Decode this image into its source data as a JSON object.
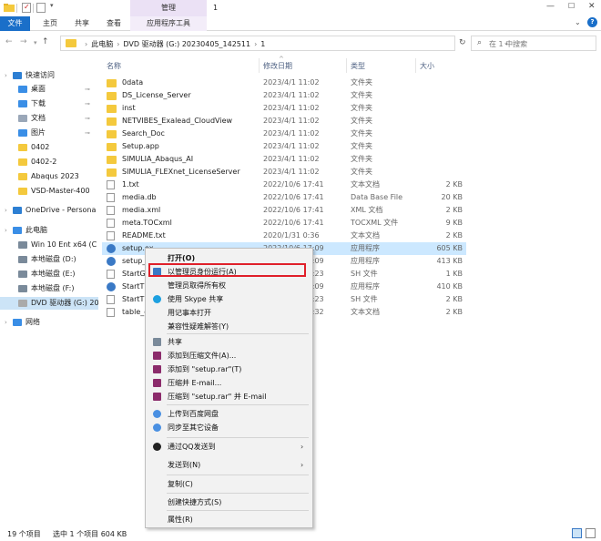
{
  "titlebar": {
    "manage_context": "管理",
    "window_title": "1"
  },
  "ribbon": {
    "tabs": [
      "文件",
      "主页",
      "共享",
      "查看",
      "应用程序工具"
    ]
  },
  "address": {
    "path": [
      "此电脑",
      "DVD 驱动器 (G:) 20230405_142511",
      "1"
    ],
    "search_placeholder": "在 1 中搜索"
  },
  "sidebar": {
    "items": [
      {
        "label": "快速访问",
        "icon": "star-icon",
        "color": "#2d7fd3"
      },
      {
        "label": "桌面",
        "icon": "desktop-icon",
        "color": "#3a8ee6",
        "pinned": true
      },
      {
        "label": "下载",
        "icon": "download-icon",
        "color": "#3a8ee6",
        "pinned": true
      },
      {
        "label": "文档",
        "icon": "documents-icon",
        "color": "#9aa7b8",
        "pinned": true
      },
      {
        "label": "图片",
        "icon": "pictures-icon",
        "color": "#3a8ee6",
        "pinned": true
      },
      {
        "label": "0402",
        "icon": "folder-icon",
        "color": "#f4c93d"
      },
      {
        "label": "0402-2",
        "icon": "folder-icon",
        "color": "#f4c93d"
      },
      {
        "label": "Abaqus 2023",
        "icon": "folder-icon",
        "color": "#f4c93d"
      },
      {
        "label": "VSD-Master-400",
        "icon": "folder-icon",
        "color": "#f4c93d"
      },
      {
        "label": "OneDrive - Persona",
        "icon": "cloud-icon",
        "color": "#2d7fd3"
      },
      {
        "label": "此电脑",
        "icon": "computer-icon",
        "color": "#3a8ee6"
      },
      {
        "label": "Win 10 Ent x64 (C",
        "icon": "drive-icon",
        "color": "#7a8a9a"
      },
      {
        "label": "本地磁盘 (D:)",
        "icon": "drive-icon",
        "color": "#7a8a9a"
      },
      {
        "label": "本地磁盘 (E:)",
        "icon": "drive-icon",
        "color": "#7a8a9a"
      },
      {
        "label": "本地磁盘 (F:)",
        "icon": "drive-icon",
        "color": "#7a8a9a"
      },
      {
        "label": "DVD 驱动器 (G:) 20",
        "icon": "dvd-icon",
        "color": "#aaaaaa"
      },
      {
        "label": "网络",
        "icon": "network-icon",
        "color": "#3a8ee6"
      }
    ]
  },
  "columns": {
    "name": "名称",
    "date": "修改日期",
    "type": "类型",
    "size": "大小"
  },
  "files": [
    {
      "name": "0data",
      "date": "2023/4/1 11:02",
      "type": "文件夹",
      "size": "",
      "kind": "folder"
    },
    {
      "name": "DS_License_Server",
      "date": "2023/4/1 11:02",
      "type": "文件夹",
      "size": "",
      "kind": "folder"
    },
    {
      "name": "inst",
      "date": "2023/4/1 11:02",
      "type": "文件夹",
      "size": "",
      "kind": "folder"
    },
    {
      "name": "NETVIBES_Exalead_CloudView",
      "date": "2023/4/1 11:02",
      "type": "文件夹",
      "size": "",
      "kind": "folder"
    },
    {
      "name": "Search_Doc",
      "date": "2023/4/1 11:02",
      "type": "文件夹",
      "size": "",
      "kind": "folder"
    },
    {
      "name": "Setup.app",
      "date": "2023/4/1 11:02",
      "type": "文件夹",
      "size": "",
      "kind": "folder"
    },
    {
      "name": "SIMULIA_Abaqus_AI",
      "date": "2023/4/1 11:02",
      "type": "文件夹",
      "size": "",
      "kind": "folder"
    },
    {
      "name": "SIMULIA_FLEXnet_LicenseServer",
      "date": "2023/4/1 11:02",
      "type": "文件夹",
      "size": "",
      "kind": "folder"
    },
    {
      "name": "1.txt",
      "date": "2022/10/6 17:41",
      "type": "文本文档",
      "size": "2 KB",
      "kind": "txt"
    },
    {
      "name": "media.db",
      "date": "2022/10/6 17:41",
      "type": "Data Base File",
      "size": "20 KB",
      "kind": "db"
    },
    {
      "name": "media.xml",
      "date": "2022/10/6 17:41",
      "type": "XML 文档",
      "size": "2 KB",
      "kind": "xml"
    },
    {
      "name": "meta.TOCxml",
      "date": "2022/10/6 17:41",
      "type": "TOCXML 文件",
      "size": "9 KB",
      "kind": "xml"
    },
    {
      "name": "README.txt",
      "date": "2020/1/31 0:36",
      "type": "文本文档",
      "size": "2 KB",
      "kind": "txt"
    },
    {
      "name": "setup.ex",
      "date": "2022/10/6 17:09",
      "type": "应用程序",
      "size": "605 KB",
      "kind": "exe",
      "selected": true
    },
    {
      "name": "setup_n",
      "date": "2022/10/6 17:09",
      "type": "应用程序",
      "size": "413 KB",
      "kind": "exe"
    },
    {
      "name": "StartGU",
      "date": "2022/10/6 17:23",
      "type": "SH 文件",
      "size": "1 KB",
      "kind": "sh"
    },
    {
      "name": "StartTU",
      "date": "2022/10/6 17:09",
      "type": "应用程序",
      "size": "410 KB",
      "kind": "exe"
    },
    {
      "name": "StartTU",
      "date": "2022/10/6 17:23",
      "type": "SH 文件",
      "size": "2 KB",
      "kind": "sh"
    },
    {
      "name": "table_of",
      "date": "2022/10/6 17:32",
      "type": "文本文档",
      "size": "2 KB",
      "kind": "txt"
    }
  ],
  "context_menu": {
    "items": [
      {
        "label": "打开(O)",
        "bold": true
      },
      {
        "label": "以管理员身份运行(A)",
        "icon": "shield-icon",
        "highlighted": true
      },
      {
        "label": "管理员取得所有权"
      },
      {
        "label": "使用 Skype 共享",
        "icon": "skype-icon"
      },
      {
        "label": "用记事本打开"
      },
      {
        "label": "兼容性疑难解答(Y)"
      },
      {
        "label": "共享",
        "icon": "share-icon"
      },
      {
        "label": "添加到压缩文件(A)...",
        "icon": "winrar-icon"
      },
      {
        "label": "添加到 \"setup.rar\"(T)",
        "icon": "winrar-icon"
      },
      {
        "label": "压缩并 E-mail...",
        "icon": "winrar-icon"
      },
      {
        "label": "压缩到 \"setup.rar\" 并 E-mail",
        "icon": "winrar-icon"
      },
      {
        "label": "上传到百度网盘",
        "icon": "baidu-cloud-icon"
      },
      {
        "label": "同步至其它设备",
        "icon": "baidu-cloud-icon"
      },
      {
        "label": "通过QQ发送到",
        "icon": "qq-icon",
        "submenu": true
      },
      {
        "label": "发送到(N)",
        "submenu": true
      },
      {
        "label": "复制(C)"
      },
      {
        "label": "创建快捷方式(S)"
      },
      {
        "label": "属性(R)"
      }
    ]
  },
  "status": {
    "item_count": "19 个项目",
    "selection": "选中 1 个项目  604 KB"
  },
  "colors": {
    "accent": "#1a6fc9",
    "selection": "#cce8ff",
    "highlight_border": "#e0202a",
    "manage_tab": "#ebe1f5"
  }
}
